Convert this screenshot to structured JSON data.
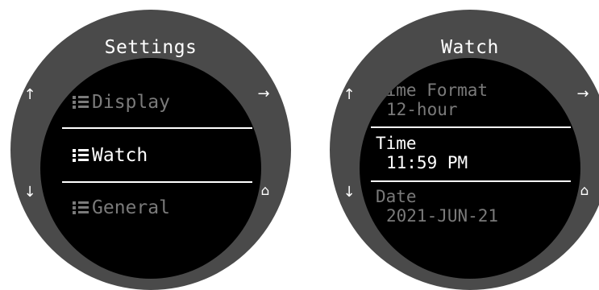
{
  "left_watch": {
    "title": "Settings",
    "buttons": {
      "up": "↑",
      "down": "↓",
      "next": "→",
      "home": "⌂"
    },
    "menu": [
      {
        "label": "Display",
        "selected": false
      },
      {
        "label": "Watch",
        "selected": true
      },
      {
        "label": "General",
        "selected": false
      }
    ]
  },
  "right_watch": {
    "title": "Watch",
    "buttons": {
      "up": "↑",
      "down": "↓",
      "next": "→",
      "home": "⌂"
    },
    "settings": [
      {
        "name": "Time Format",
        "value": "12-hour",
        "selected": false
      },
      {
        "name": "Time",
        "value": "11:59 PM",
        "selected": true
      },
      {
        "name": "Date",
        "value": "2021-JUN-21",
        "selected": false
      }
    ]
  },
  "colors": {
    "bezel": "#4a4a4a",
    "screen": "#000000",
    "text_active": "#ffffff",
    "text_inactive": "#7a7a7a"
  }
}
